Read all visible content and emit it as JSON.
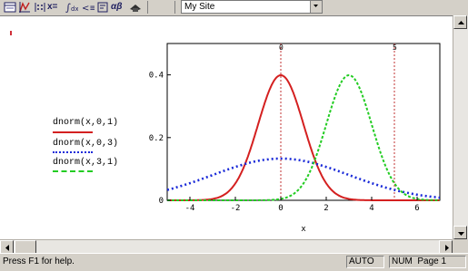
{
  "toolbar": {
    "icons": [
      "graph-toolbar-icon",
      "xy-plot-icon",
      "matrix-icon",
      "evaluation-icon",
      "calculus-icon",
      "boolean-icon",
      "programming-icon",
      "greek-icon",
      "symbolic-icon"
    ],
    "evaluation_label": "x=",
    "greek_label": "αβ",
    "site_combo_value": "My Site"
  },
  "plot": {
    "legend": [
      {
        "label": "dnorm(x,0,1)",
        "color": "#d42020",
        "style": "solid"
      },
      {
        "label": "dnorm(x,0,3)",
        "color": "#1a2ad8",
        "style": "dotted"
      },
      {
        "label": "dnorm(x,3,1)",
        "color": "#22cc22",
        "style": "dashed"
      }
    ],
    "xlabel": "x",
    "x_ticks": [
      "-4",
      "-2",
      "0",
      "2",
      "4",
      "6"
    ],
    "y_ticks": [
      "0",
      "0.2",
      "0.4"
    ],
    "marker_labels": [
      "0",
      "5"
    ]
  },
  "chart_data": {
    "type": "line",
    "xlim": [
      -5,
      7
    ],
    "ylim": [
      0,
      0.5
    ],
    "xlabel": "x",
    "ylabel": "",
    "grid": false,
    "vertical_markers": [
      0,
      5
    ],
    "series": [
      {
        "name": "dnorm(x,0,1)",
        "mean": 0,
        "sd": 1,
        "color": "#d42020",
        "style": "solid"
      },
      {
        "name": "dnorm(x,0,3)",
        "mean": 0,
        "sd": 3,
        "color": "#1a2ad8",
        "style": "dotted"
      },
      {
        "name": "dnorm(x,3,1)",
        "mean": 3,
        "sd": 1,
        "color": "#22cc22",
        "style": "dashed"
      }
    ]
  },
  "status": {
    "help_text": "Press F1 for help.",
    "mode": "AUTO",
    "num": "NUM",
    "page": "Page 1"
  }
}
